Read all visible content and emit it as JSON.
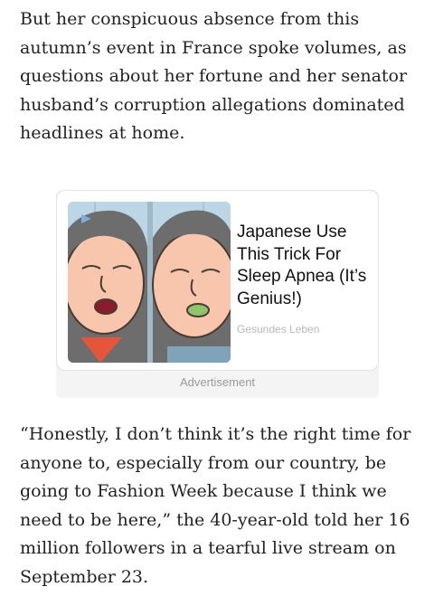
{
  "article": {
    "paragraph_1": "But her conspicuous absence from this autumn’s event in France spoke volumes, as questions about her fortune and her senator husband’s corruption allegations dominated headlines at home.",
    "paragraph_2": "“Honestly, I don’t think it’s the right time for anyone to, especially from our country, be going to Fashion Week because I think we need to be here,” the 40-year-old told her 16 million followers in a tearful live stream on September 23."
  },
  "ad": {
    "headline": "Japanese Use This Trick For Sleep Apnea (It’s Genius!)",
    "source": "Gesundes Leben",
    "label": "Advertisement",
    "image_icon": "adchoices-icon"
  },
  "colors": {
    "text": "#222222",
    "ad_source": "#b8b8b8",
    "ad_label": "#9a9a9a",
    "ad_background": "#f4f4f4"
  }
}
